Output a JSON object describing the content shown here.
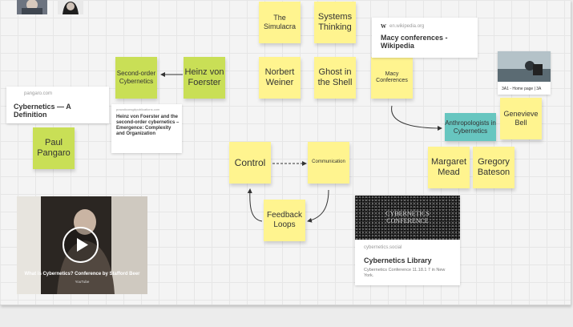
{
  "stickies": {
    "simulacra": "The Simulacra",
    "systems_thinking": "Systems Thinking",
    "norbert": "Norbert Weiner",
    "ghost": "Ghost in the Shell",
    "macy": "Macy Conferences",
    "second_order": "Second-order Cybernetics",
    "heinz": "Heinz von Foerster",
    "paul": "Paul Pangaro",
    "control": "Control",
    "communication": "Communication",
    "feedback": "Feedback Loops",
    "anthropologists": "Anthropologists in Cybernetics",
    "genevieve": "Genevieve Bell",
    "margaret": "Margaret Mead",
    "gregory": "Gregory Bateson"
  },
  "cards": {
    "wiki": {
      "source": "en.wikipedia.org",
      "title": "Macy conferences - Wikipedia"
    },
    "pangaro": {
      "source": "pangaro.com",
      "title": "Cybernetics — A Definition"
    },
    "foerster": {
      "source": "pracsticonsgitpublications.com",
      "title": "Heinz von Foerster and the second-order cybernetics – Emergence: Complexity and Organization"
    },
    "library": {
      "source": "cybernetics.social",
      "title": "Cybernetics Library",
      "description": "Cybernetics Conference 11.18.1 7 in New York.",
      "image_text": "CYBERNETICS CONFERENCE"
    },
    "anu": {
      "label": "3A1 - Home page | 3A"
    }
  },
  "video": {
    "title": "What is Cybernetics? Conference by Stafford Beer",
    "source": "YouTube"
  }
}
